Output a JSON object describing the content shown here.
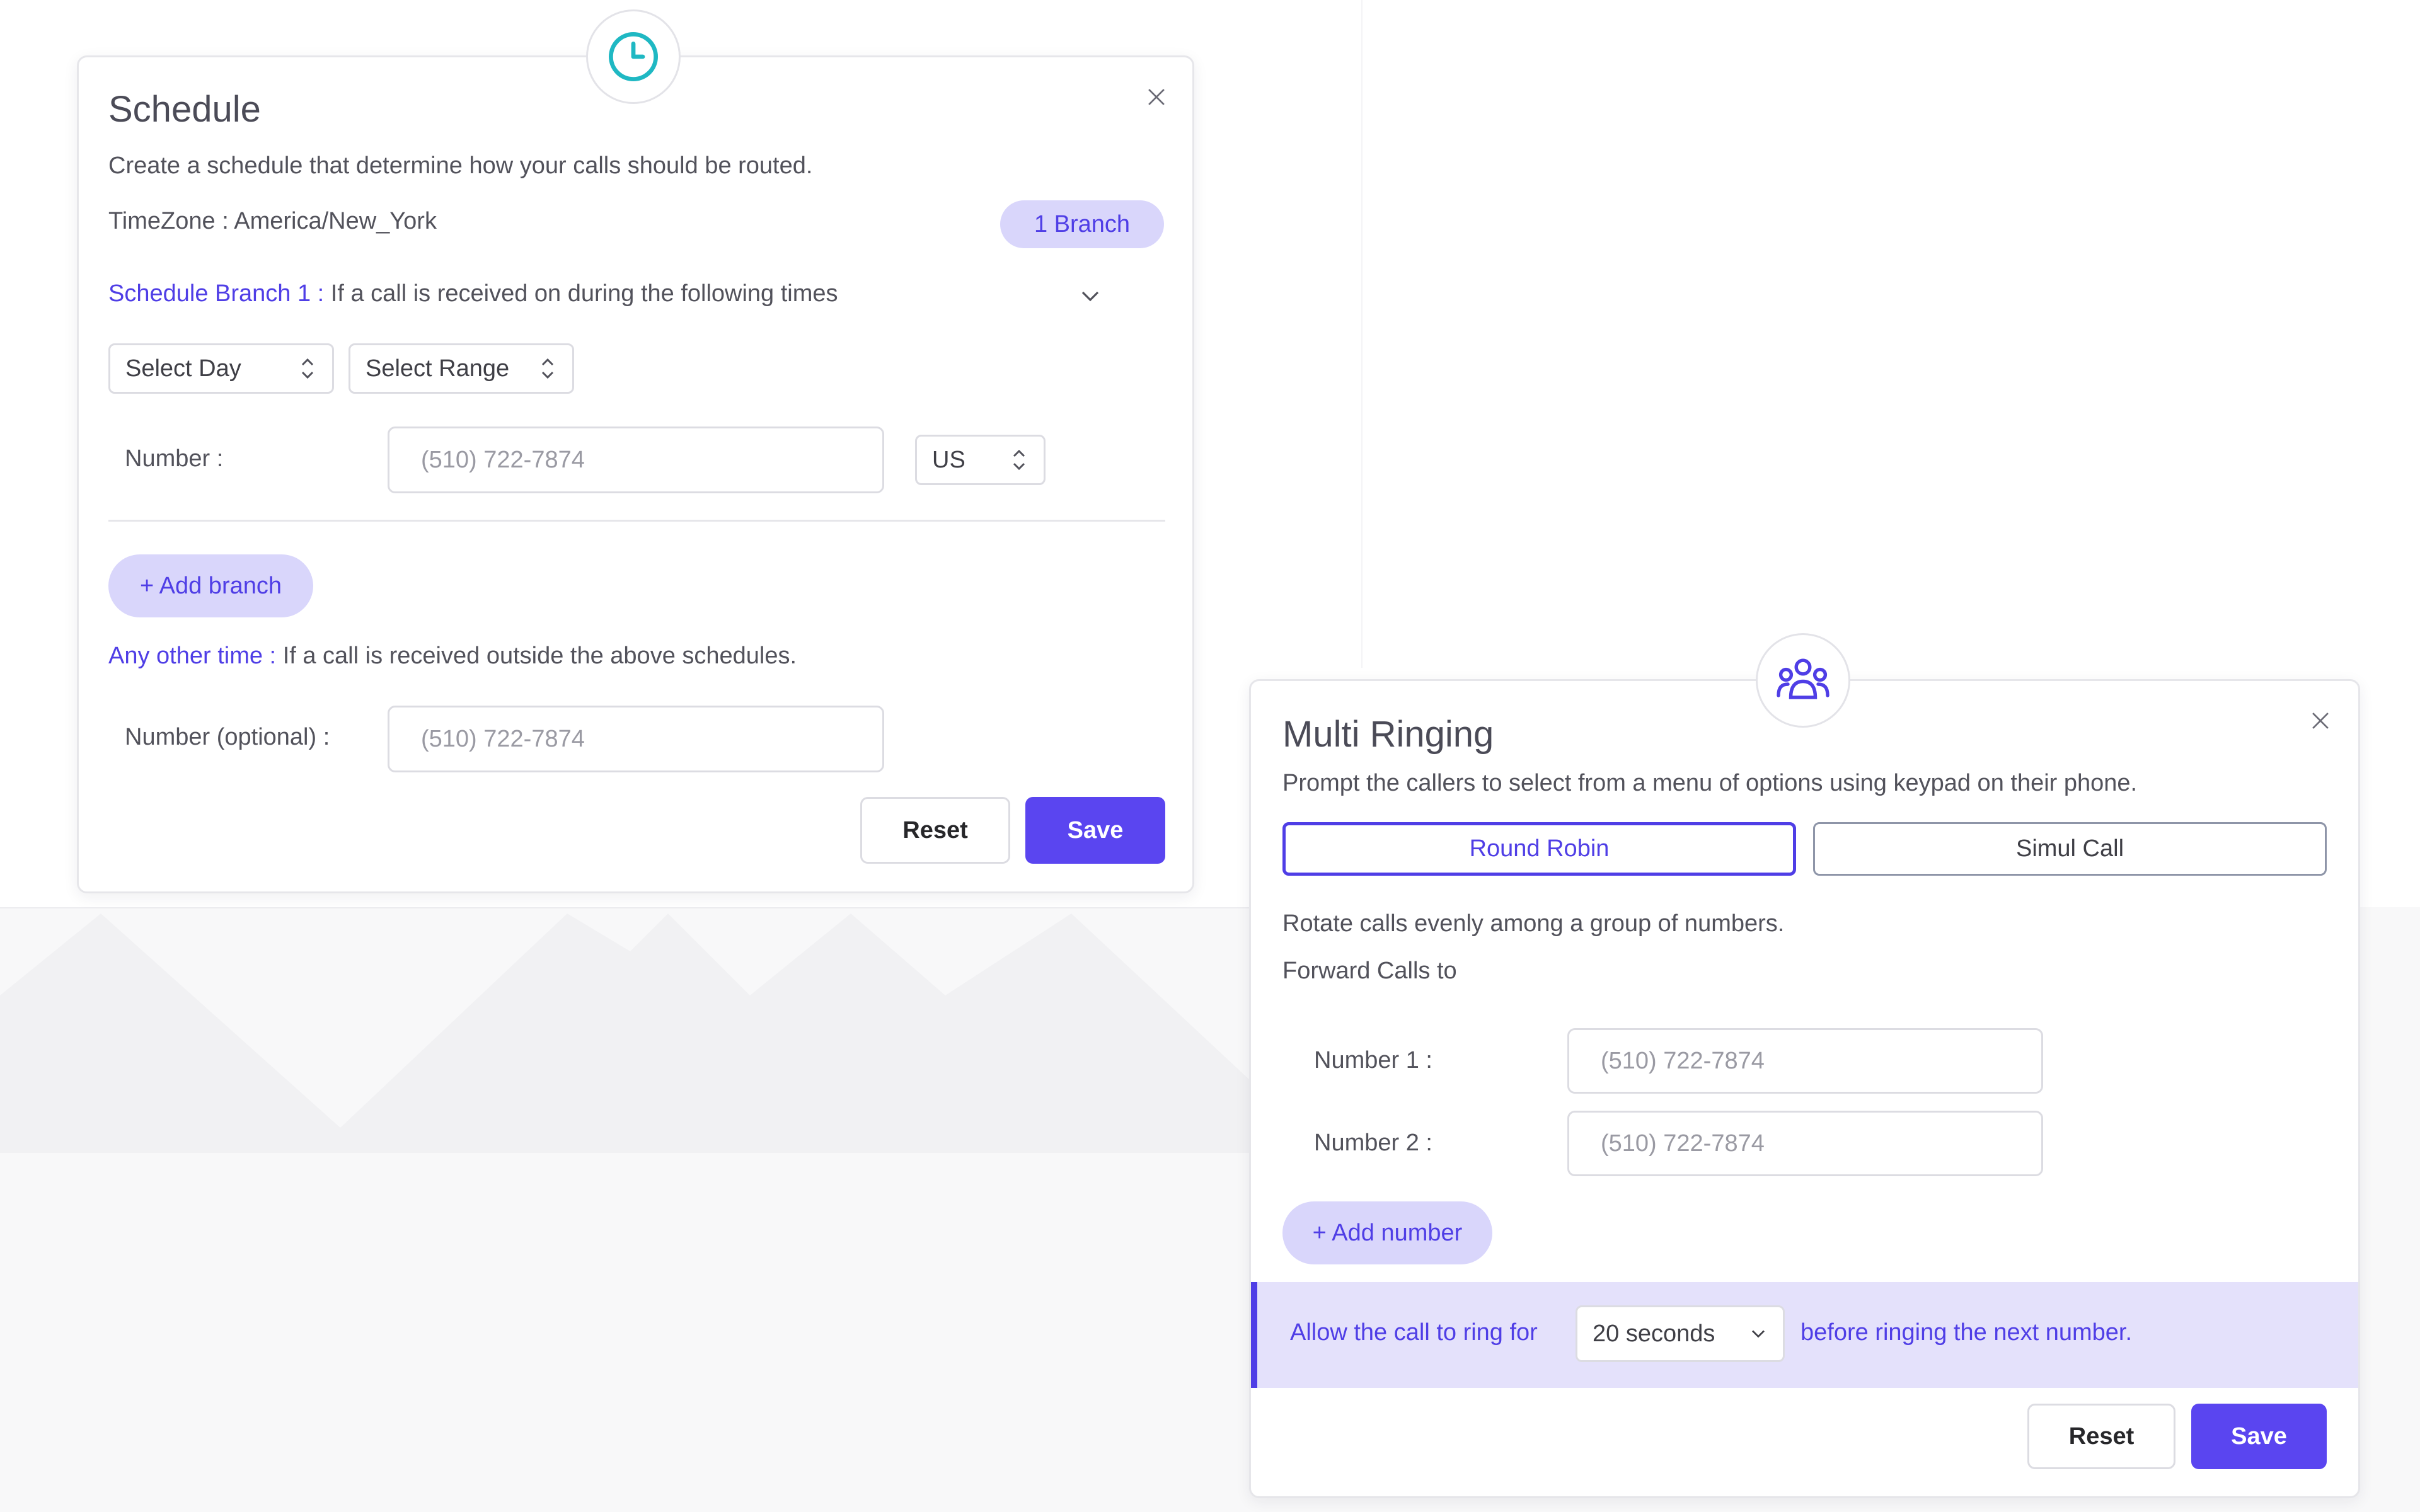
{
  "colors": {
    "accent": "#4f3ee6",
    "accent_light": "#d9d6fb",
    "save_button": "#5a45f0",
    "schedule_icon": "#1fb8c3",
    "ring_bar": "#e4e1fb"
  },
  "schedule": {
    "icon": "clock-icon",
    "title": "Schedule",
    "description": "Create a schedule that determine how your calls should be routed.",
    "timezone_label": "TimeZone :",
    "timezone_value": "America/New_York",
    "branch_count": "1 Branch",
    "branch_label": "Schedule Branch 1 :",
    "branch_text": "If a call is received on during the following times",
    "select_day": "Select Day",
    "select_range": "Select Range",
    "number_label": "Number :",
    "number_placeholder": "(510) 722-7874",
    "country": "US",
    "add_branch": "+ Add branch",
    "other_label": "Any other time :",
    "other_text": "If a call is received outside the above schedules.",
    "optional_label": "Number (optional) :",
    "optional_placeholder": "(510) 722-7874",
    "reset": "Reset",
    "save": "Save"
  },
  "multi_ringing": {
    "icon": "users-group-icon",
    "title": "Multi Ringing",
    "description": "Prompt the callers to select from a menu of options using keypad on their phone.",
    "tabs": [
      {
        "label": "Round Robin",
        "active": true
      },
      {
        "label": "Simul Call",
        "active": false
      }
    ],
    "rotate_text": "Rotate calls evenly among a group of numbers.",
    "forward_label": "Forward Calls to",
    "number1_label": "Number 1 :",
    "number1_placeholder": "(510) 722-7874",
    "number2_label": "Number 2 :",
    "number2_placeholder": "(510) 722-7874",
    "add_number": "+ Add number",
    "ring_prefix": "Allow the call to ring for",
    "ring_value": "20 seconds",
    "ring_suffix": "before ringing the next number.",
    "reset": "Reset",
    "save": "Save"
  }
}
